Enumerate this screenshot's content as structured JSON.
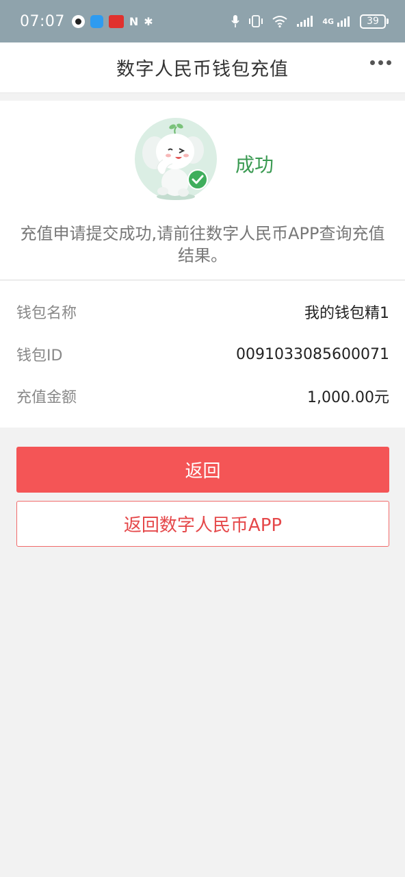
{
  "status_bar": {
    "time": "07:07",
    "battery": "39",
    "network": "4G",
    "icons": [
      "qq-icon",
      "message-icon",
      "app-icon",
      "nfc-icon",
      "bluetooth-icon",
      "mic-icon",
      "vibrate-icon",
      "wifi-icon",
      "signal-icon",
      "battery-icon"
    ]
  },
  "nav": {
    "title": "数字人民币钱包充值",
    "more_icon": "more-dots-icon"
  },
  "result": {
    "status": "成功",
    "message": "充值申请提交成功,请前往数字人民币APP查询充值结果。",
    "status_color": "#3a9a52"
  },
  "details": [
    {
      "label": "钱包名称",
      "value": "我的钱包精1"
    },
    {
      "label": "钱包ID",
      "value": "0091033085600071"
    },
    {
      "label": "充值金额",
      "value": "1,000.00元"
    }
  ],
  "actions": {
    "back_label": "返回",
    "back_app_label": "返回数字人民币APP",
    "accent_color": "#f45556"
  }
}
